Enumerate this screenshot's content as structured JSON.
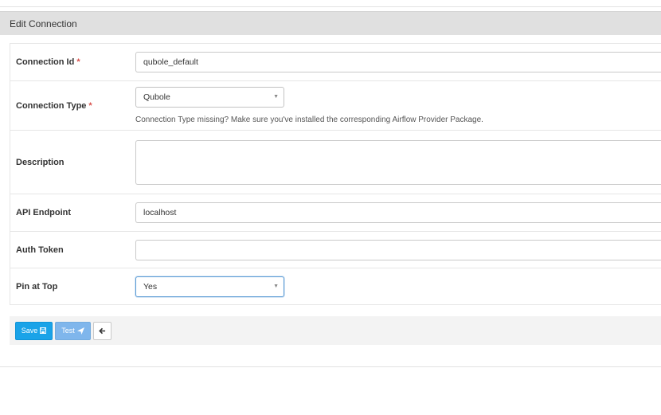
{
  "panel": {
    "title": "Edit Connection"
  },
  "fields": {
    "connection_id": {
      "label": "Connection Id",
      "value": "qubole_default"
    },
    "connection_type": {
      "label": "Connection Type",
      "selected": "Qubole",
      "help": "Connection Type missing? Make sure you've installed the corresponding Airflow Provider Package."
    },
    "description": {
      "label": "Description",
      "value": ""
    },
    "api_endpoint": {
      "label": "API Endpoint",
      "value": "localhost"
    },
    "auth_token": {
      "label": "Auth Token",
      "value": ""
    },
    "pin_at_top": {
      "label": "Pin at Top",
      "selected": "Yes"
    }
  },
  "required_marker": "*",
  "actions": {
    "save_label": "Save",
    "test_label": "Test",
    "back_icon": "arrow-left-icon"
  },
  "colors": {
    "save": "#1aa3e8",
    "test": "#7fb6ec",
    "required": "#d9534f"
  }
}
